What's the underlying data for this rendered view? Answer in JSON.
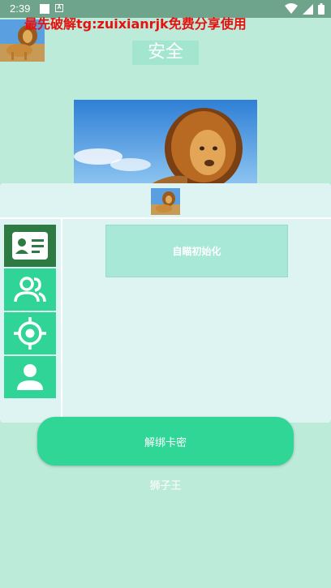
{
  "status_bar": {
    "time": "2:39",
    "icons": [
      "notification-square",
      "accessibility-a",
      "wifi-icon",
      "signal-icon",
      "battery-icon"
    ]
  },
  "banner": {
    "text": "最先破解tg:zuixianrjk免费分享使用",
    "color": "#e8110f"
  },
  "header": {
    "title": "安全",
    "avatar_icon": "lion-image"
  },
  "hero": {
    "image_icon": "lion-image"
  },
  "panel": {
    "thumb_icon": "lion-image",
    "sidebar": [
      {
        "icon": "id-card-icon",
        "active": true
      },
      {
        "icon": "users-icon",
        "active": false
      },
      {
        "icon": "crosshair-icon",
        "active": false
      },
      {
        "icon": "user-icon",
        "active": false
      }
    ],
    "init_button_label": "自瞄初始化"
  },
  "unbind_button_label": "解绑卡密",
  "footer_label": "狮子王",
  "colors": {
    "background": "#bdebd9",
    "accent_green": "#30d696",
    "active_green": "#2d7a43",
    "panel_bg": "#def4f3"
  }
}
